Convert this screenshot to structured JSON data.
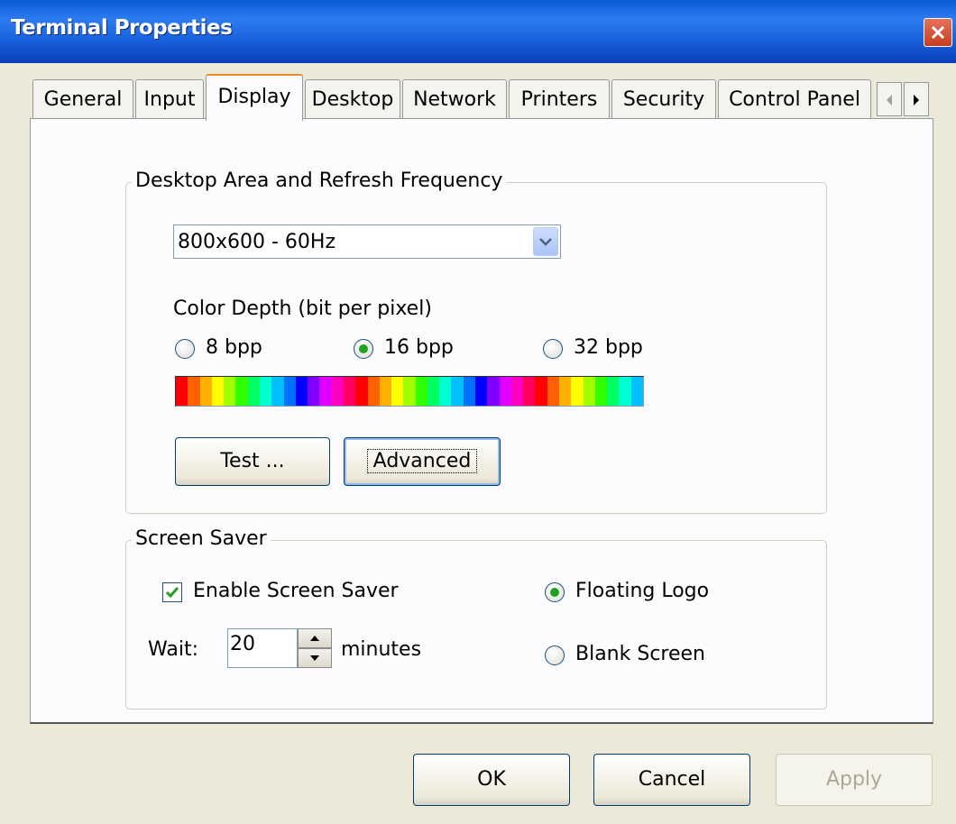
{
  "window": {
    "title": "Terminal Properties"
  },
  "tabs": [
    {
      "label": "General"
    },
    {
      "label": "Input"
    },
    {
      "label": "Display",
      "active": true
    },
    {
      "label": "Desktop"
    },
    {
      "label": "Network"
    },
    {
      "label": "Printers"
    },
    {
      "label": "Security"
    },
    {
      "label": "Control Panel"
    }
  ],
  "display": {
    "area_group_label": "Desktop Area and Refresh Frequency",
    "resolution_value": "800x600 - 60Hz",
    "color_depth_label": "Color Depth (bit per pixel)",
    "color_depth_options": [
      {
        "label": "8 bpp",
        "selected": false
      },
      {
        "label": "16 bpp",
        "selected": true
      },
      {
        "label": "32 bpp",
        "selected": false
      }
    ],
    "colorbar_colors": [
      "#ff0000",
      "#ff6000",
      "#ffb000",
      "#ffff00",
      "#a0ff00",
      "#30ff00",
      "#00ff60",
      "#00ffd0",
      "#00c0ff",
      "#0070ff",
      "#0000ff",
      "#8000ff",
      "#e000ff",
      "#ff00c0",
      "#ff0060",
      "#ff0000",
      "#ff6000",
      "#ffb000",
      "#ffff00",
      "#a0ff00",
      "#30ff00",
      "#00ff60",
      "#00ffd0",
      "#00c0ff",
      "#0070ff",
      "#0000ff",
      "#8000ff",
      "#e000ff",
      "#ff00c0",
      "#ff0060",
      "#ff0000",
      "#ff6000",
      "#ffb000",
      "#ffff00",
      "#a0ff00",
      "#30ff00",
      "#00ff60",
      "#00ffd0",
      "#00c0ff"
    ],
    "test_button_label": "Test ...",
    "advanced_button_label": "Advanced"
  },
  "screensaver": {
    "group_label": "Screen Saver",
    "enable_label": "Enable Screen Saver",
    "enabled": true,
    "wait_label": "Wait:",
    "wait_value": "20",
    "minutes_label": "minutes",
    "floating_logo_label": "Floating Logo",
    "floating_logo_selected": true,
    "blank_screen_label": "Blank Screen",
    "blank_screen_selected": false
  },
  "buttons": {
    "ok": "OK",
    "cancel": "Cancel",
    "apply": "Apply"
  },
  "colors": {
    "title_bar": "#0a5ad8",
    "tab_highlight": "#e68b2c",
    "radio_check": "#21a121",
    "panel_bg": "#fcfcfe",
    "dialog_bg": "#ece9d8"
  }
}
